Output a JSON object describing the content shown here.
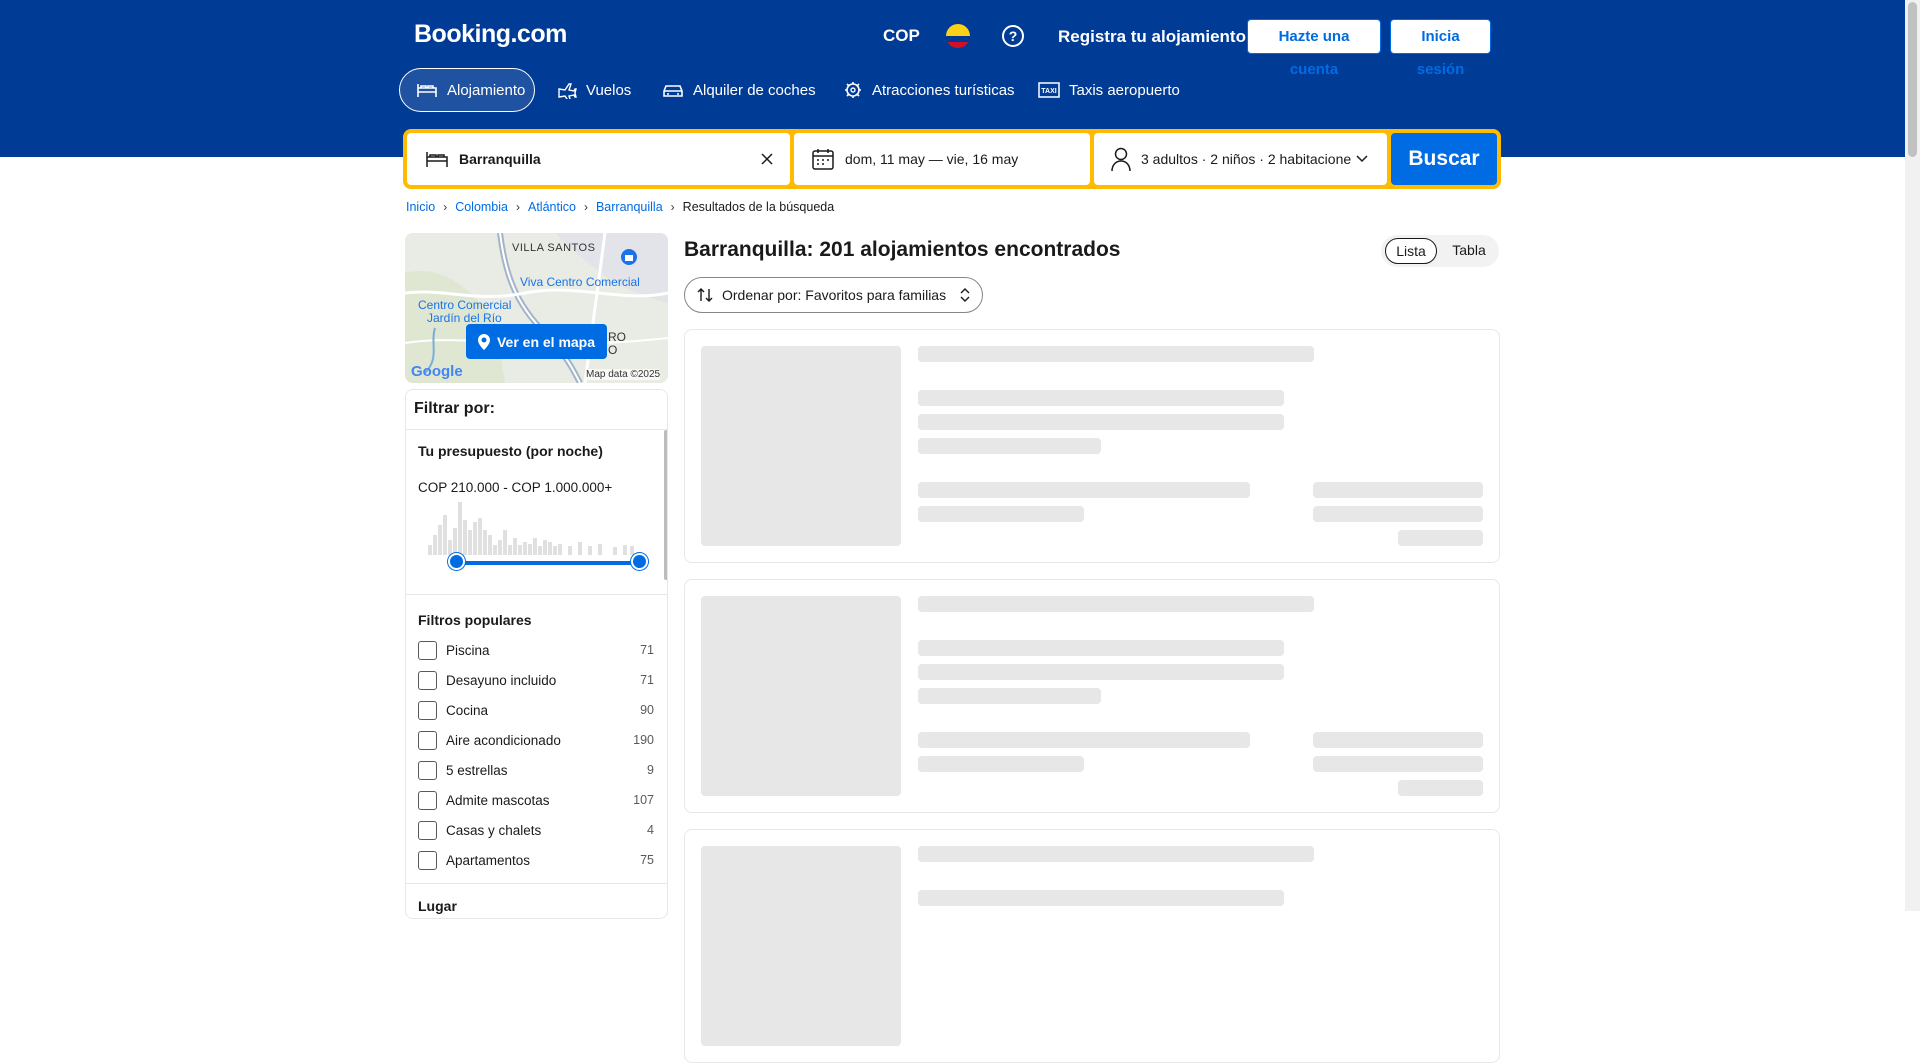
{
  "header": {
    "logo": "Booking.com",
    "currency": "COP",
    "help_icon": "question-circle-icon",
    "register_property": "Registra tu alojamiento",
    "create_account": "Hazte una cuenta",
    "sign_in": "Inicia sesión",
    "flag_colors": [
      "#fcd116",
      "#003893",
      "#ce1126"
    ]
  },
  "nav": [
    {
      "label": "Alojamiento",
      "icon": "bed-icon",
      "active": true
    },
    {
      "label": "Vuelos",
      "icon": "plane-icon",
      "active": false
    },
    {
      "label": "Alquiler de coches",
      "icon": "car-icon",
      "active": false
    },
    {
      "label": "Atracciones turísticas",
      "icon": "attractions-icon",
      "active": false
    },
    {
      "label": "Taxis aeropuerto",
      "icon": "taxi-icon",
      "active": false
    }
  ],
  "search": {
    "destination": "Barranquilla",
    "dates": "dom, 11 may — vie, 16 may",
    "occupancy": "3 adultos · 2 niños · 2 habitacione",
    "button": "Buscar"
  },
  "breadcrumbs": [
    "Inicio",
    "Colombia",
    "Atlántico",
    "Barranquilla",
    "Resultados de la búsqueda"
  ],
  "map": {
    "labels": [
      "VILLA SANTOS",
      "Viva Centro Comercial",
      "Centro Comercial",
      "Jardín del Río",
      "RO",
      "O"
    ],
    "button": "Ver en el mapa",
    "attribution": "Map data ©2025",
    "google": "Google"
  },
  "filters": {
    "title": "Filtrar por:",
    "budget_title": "Tu presupuesto (por noche)",
    "budget_value": "COP 210.000 - COP 1.000.000+",
    "popular_title": "Filtros populares",
    "items": [
      {
        "label": "Piscina",
        "count": "71"
      },
      {
        "label": "Desayuno incluido",
        "count": "71"
      },
      {
        "label": "Cocina",
        "count": "90"
      },
      {
        "label": "Aire acondicionado",
        "count": "190"
      },
      {
        "label": "5 estrellas",
        "count": "9"
      },
      {
        "label": "Admite mascotas",
        "count": "107"
      },
      {
        "label": "Casas y chalets",
        "count": "4"
      },
      {
        "label": "Apartamentos",
        "count": "75"
      }
    ],
    "next_section": "Lugar"
  },
  "results": {
    "title": "Barranquilla: 201 alojamientos encontrados",
    "view_list": "Lista",
    "view_table": "Tabla",
    "sort": "Ordenar por: Favoritos para familias"
  },
  "colors": {
    "brand_blue": "#003b95",
    "action_blue": "#006ce4",
    "search_yellow": "#febb02"
  }
}
